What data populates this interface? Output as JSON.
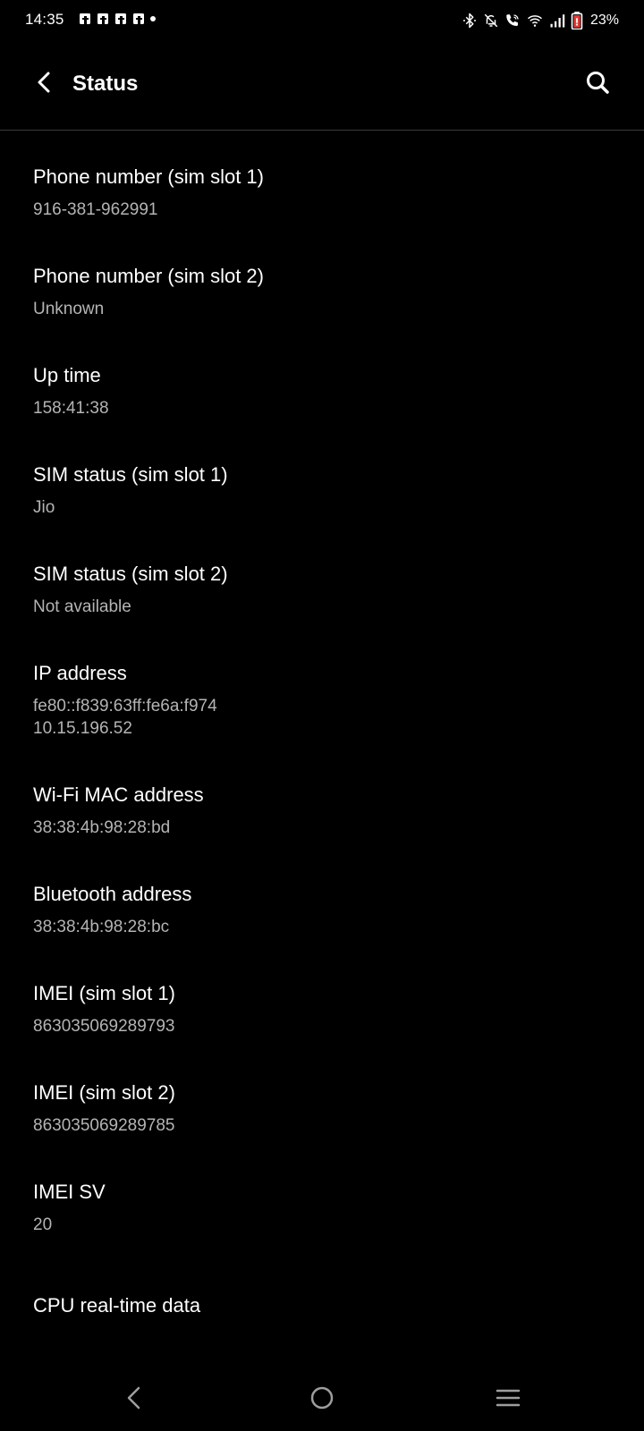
{
  "status_bar": {
    "time": "14:35",
    "notifications": [
      "facebook-icon",
      "facebook-icon",
      "facebook-icon",
      "facebook-icon",
      "more-dot"
    ],
    "system_icons": [
      "bluetooth-icon",
      "silent-icon",
      "wifi-calling-icon",
      "wifi-icon",
      "signal-icon",
      "battery-low-icon"
    ],
    "battery_percent": "23%",
    "battery_color": "#e53935"
  },
  "app_bar": {
    "title": "Status",
    "back_icon": "arrow-back-icon",
    "search_icon": "search-icon"
  },
  "items": [
    {
      "title": "Phone number (sim slot 1)",
      "value": "916-381-962991"
    },
    {
      "title": "Phone number (sim slot 2)",
      "value": "Unknown"
    },
    {
      "title": "Up time",
      "value": "158:41:38"
    },
    {
      "title": "SIM status (sim slot 1)",
      "value": "Jio"
    },
    {
      "title": "SIM status (sim slot 2)",
      "value": "Not available"
    },
    {
      "title": "IP address",
      "value": "fe80::f839:63ff:fe6a:f974\n10.15.196.52"
    },
    {
      "title": "Wi-Fi MAC address",
      "value": "38:38:4b:98:28:bd"
    },
    {
      "title": "Bluetooth address",
      "value": "38:38:4b:98:28:bc"
    },
    {
      "title": "IMEI (sim slot 1)",
      "value": "863035069289793"
    },
    {
      "title": "IMEI (sim slot 2)",
      "value": "863035069289785"
    },
    {
      "title": "IMEI SV",
      "value": "20"
    },
    {
      "title": "CPU real-time data"
    }
  ],
  "nav_bar": {
    "buttons": [
      "nav-back-icon",
      "nav-home-icon",
      "nav-recents-icon"
    ]
  },
  "colors": {
    "background": "#000000",
    "title_text": "#ffffff",
    "value_text": "#b4b4b4",
    "divider": "#3a3a3a",
    "nav_icons": "#9e9e9e"
  }
}
